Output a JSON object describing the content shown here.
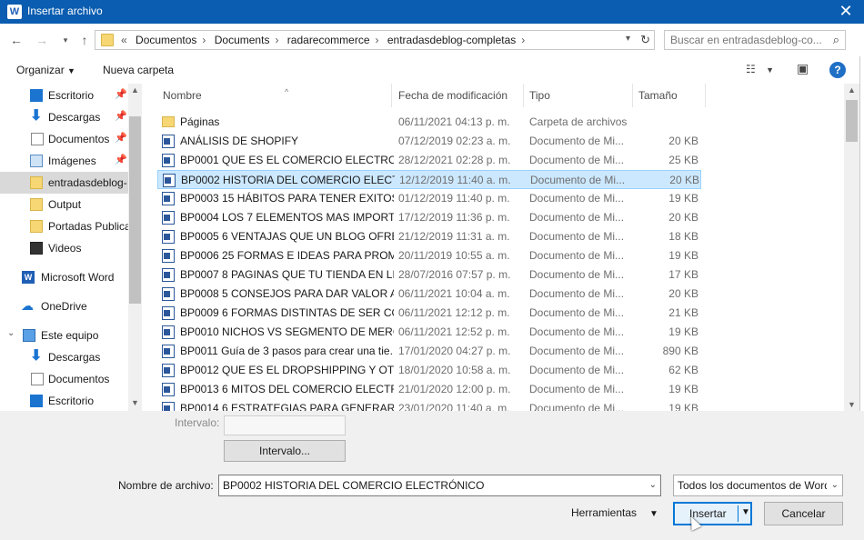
{
  "window": {
    "title": "Insertar archivo",
    "app_icon_letter": "W"
  },
  "nav": {
    "breadcrumb": [
      "Documentos",
      "Documents",
      "radarecommerce",
      "entradasdeblog-completas"
    ],
    "overflow_label": "«",
    "search_placeholder": "Buscar en entradasdeblog-co..."
  },
  "commandbar": {
    "organize": "Organizar",
    "new_folder": "Nueva carpeta"
  },
  "sidebar": {
    "items": [
      {
        "label": "Escritorio",
        "icon": "desktop-icon",
        "pinned": true
      },
      {
        "label": "Descargas",
        "icon": "download-icon",
        "pinned": true
      },
      {
        "label": "Documentos",
        "icon": "documents-icon",
        "pinned": true
      },
      {
        "label": "Imágenes",
        "icon": "pictures-icon",
        "pinned": true
      },
      {
        "label": "entradasdeblog-",
        "icon": "folder-icon",
        "selected": true
      },
      {
        "label": "Output",
        "icon": "folder-icon"
      },
      {
        "label": "Portadas Publica",
        "icon": "folder-icon"
      },
      {
        "label": "Videos",
        "icon": "video-icon"
      },
      {
        "label": "Microsoft Word",
        "icon": "word-icon"
      },
      {
        "label": "OneDrive",
        "icon": "onedrive-icon"
      },
      {
        "label": "Este equipo",
        "icon": "computer-icon"
      },
      {
        "label": "Descargas",
        "icon": "download-icon"
      },
      {
        "label": "Documentos",
        "icon": "documents-icon"
      },
      {
        "label": "Escritorio",
        "icon": "desktop-icon"
      }
    ]
  },
  "columns": {
    "name": "Nombre",
    "date": "Fecha de modificación",
    "type": "Tipo",
    "size": "Tamaño"
  },
  "files": [
    {
      "name": "Páginas",
      "date": "06/11/2021 04:13 p. m.",
      "type": "Carpeta de archivos",
      "size": "",
      "kind": "folder"
    },
    {
      "name": "ANÁLISIS DE SHOPIFY",
      "date": "07/12/2019 02:23 a. m.",
      "type": "Documento de Mi...",
      "size": "20 KB",
      "kind": "word"
    },
    {
      "name": "BP0001 QUE ES EL COMERCIO ELECTRO...",
      "date": "28/12/2021 02:28 p. m.",
      "type": "Documento de Mi...",
      "size": "25 KB",
      "kind": "word"
    },
    {
      "name": "BP0002 HISTORIA DEL COMERCIO ELECT...",
      "date": "12/12/2019 11:40 a. m.",
      "type": "Documento de Mi...",
      "size": "20 KB",
      "kind": "word",
      "selected": true
    },
    {
      "name": "BP0003 15 HÁBITOS PARA TENER EXITOS ...",
      "date": "01/12/2019 11:40 p. m.",
      "type": "Documento de Mi...",
      "size": "19 KB",
      "kind": "word"
    },
    {
      "name": "BP0004 LOS 7 ELEMENTOS MAS IMPORT...",
      "date": "17/12/2019 11:36 p. m.",
      "type": "Documento de Mi...",
      "size": "20 KB",
      "kind": "word"
    },
    {
      "name": "BP0005 6 VENTAJAS QUE UN BLOG OFRE...",
      "date": "21/12/2019 11:31 a. m.",
      "type": "Documento de Mi...",
      "size": "18 KB",
      "kind": "word"
    },
    {
      "name": "BP0006 25 FORMAS E IDEAS PARA PROM...",
      "date": "20/11/2019 10:55 a. m.",
      "type": "Documento de Mi...",
      "size": "19 KB",
      "kind": "word"
    },
    {
      "name": "BP0007 8 PAGINAS QUE TU TIENDA EN LI...",
      "date": "28/07/2016 07:57 p. m.",
      "type": "Documento de Mi...",
      "size": "17 KB",
      "kind": "word"
    },
    {
      "name": "BP0008 5 CONSEJOS PARA DAR VALOR A...",
      "date": "06/11/2021 10:04 a. m.",
      "type": "Documento de Mi...",
      "size": "20 KB",
      "kind": "word"
    },
    {
      "name": "BP0009 6 FORMAS DISTINTAS DE SER CO...",
      "date": "06/11/2021 12:12 p. m.",
      "type": "Documento de Mi...",
      "size": "21 KB",
      "kind": "word"
    },
    {
      "name": "BP0010 NICHOS VS SEGMENTO DE MERC...",
      "date": "06/11/2021 12:52 p. m.",
      "type": "Documento de Mi...",
      "size": "19 KB",
      "kind": "word"
    },
    {
      "name": "BP0011 Guía de 3 pasos para crear una tie...",
      "date": "17/01/2020 04:27 p. m.",
      "type": "Documento de Mi...",
      "size": "890 KB",
      "kind": "word"
    },
    {
      "name": "BP0012 QUE ES EL DROPSHIPPING Y OTR...",
      "date": "18/01/2020 10:58 a. m.",
      "type": "Documento de Mi...",
      "size": "62 KB",
      "kind": "word"
    },
    {
      "name": "BP0013 6 MITOS DEL COMERCIO ELECTR...",
      "date": "21/01/2020 12:00 p. m.",
      "type": "Documento de Mi...",
      "size": "19 KB",
      "kind": "word"
    },
    {
      "name": "BP0014 6 ESTRATEGIAS PARA GENERAR C...",
      "date": "23/01/2020 11:40 a. m.",
      "type": "Documento de Mi...",
      "size": "19 KB",
      "kind": "word"
    }
  ],
  "bottom": {
    "interval_label": "Intervalo:",
    "interval_button": "Intervalo...",
    "filename_label": "Nombre de archivo:",
    "filename_value": "BP0002 HISTORIA DEL COMERCIO ELECTRÓNICO",
    "filter_value": "Todos los documentos de Word",
    "tools_label": "Herramientas",
    "insert_label": "Insertar",
    "cancel_label": "Cancelar"
  },
  "colors": {
    "titlebar": "#0a5db0",
    "selection": "#cce8ff",
    "accent": "#0078d7"
  }
}
